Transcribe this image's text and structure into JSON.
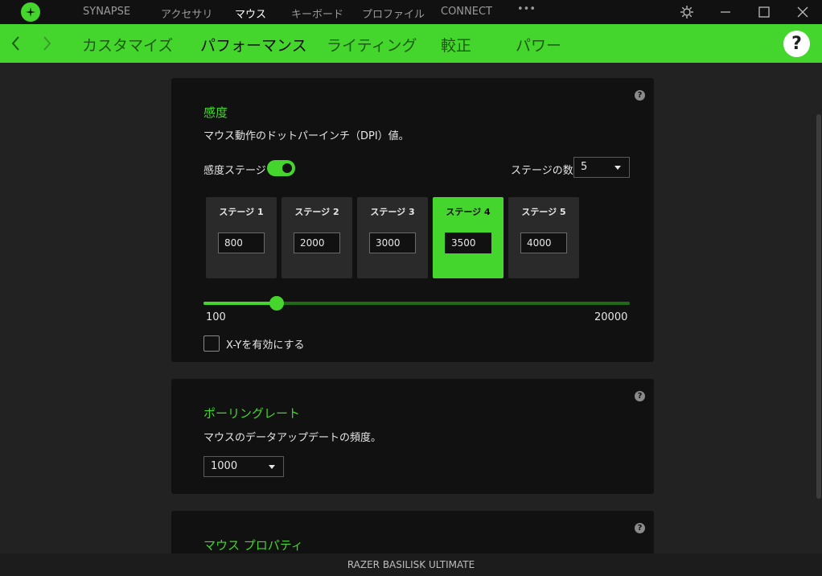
{
  "topnav": {
    "items": [
      "SYNAPSE",
      "アクセサリ",
      "マウス",
      "キーボード",
      "プロファイル",
      "CONNECT"
    ],
    "more": "•••"
  },
  "subnav": {
    "items": [
      "カスタマイズ",
      "パフォーマンス",
      "ライティング",
      "較正",
      "パワー"
    ],
    "help": "?"
  },
  "sensitivity": {
    "title": "感度",
    "description": "マウス動作のドットパーインチ（DPI）値。",
    "stages_label": "感度ステージ",
    "stage_count_label": "ステージの数",
    "stage_count": "5",
    "stages": [
      {
        "label": "ステージ 1",
        "value": "800"
      },
      {
        "label": "ステージ 2",
        "value": "2000"
      },
      {
        "label": "ステージ 3",
        "value": "3000"
      },
      {
        "label": "ステージ 4",
        "value": "3500"
      },
      {
        "label": "ステージ 5",
        "value": "4000"
      }
    ],
    "slider_min": "100",
    "slider_max": "20000",
    "slider_value": 3500,
    "xy_label": "X-Yを有効にする",
    "help": "?"
  },
  "polling": {
    "title": "ポーリングレート",
    "description": "マウスのデータアップデートの頻度。",
    "value": "1000",
    "help": "?"
  },
  "mouse_props": {
    "title": "マウス プロパティ",
    "help": "?"
  },
  "footer": {
    "device": "RAZER BASILISK ULTIMATE"
  },
  "colors": {
    "accent": "#44d62c",
    "background": "#222222",
    "card": "#111111"
  }
}
